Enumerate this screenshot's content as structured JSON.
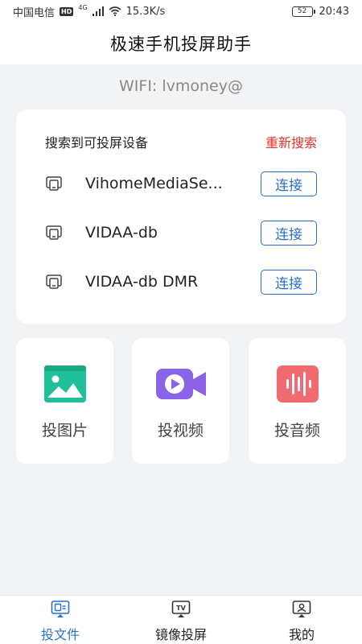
{
  "status_bar": {
    "carrier": "中国电信",
    "hd": "HD",
    "network": "4G",
    "speed": "15.3K/s",
    "battery": "52",
    "time": "20:43"
  },
  "header": {
    "title": "极速手机投屏助手"
  },
  "wifi": {
    "label": "WIFI: lvmoney@"
  },
  "device_card": {
    "title": "搜索到可投屏设备",
    "rescan_label": "重新搜索",
    "devices": [
      {
        "name": "VihomeMediaSe...",
        "connect_label": "连接",
        "icon": "cast-screen-icon"
      },
      {
        "name": "VIDAA-db",
        "connect_label": "连接",
        "icon": "cast-screen-icon"
      },
      {
        "name": "VIDAA-db DMR",
        "connect_label": "连接",
        "icon": "cast-screen-icon"
      }
    ]
  },
  "tiles": [
    {
      "label": "投图片",
      "icon": "image-icon",
      "color": "#1fbf9a"
    },
    {
      "label": "投视频",
      "icon": "video-camera-icon",
      "color": "#8a63e8"
    },
    {
      "label": "投音频",
      "icon": "audio-wave-icon",
      "color": "#f06a6f"
    }
  ],
  "bottom_nav": {
    "items": [
      {
        "label": "投文件",
        "icon": "cast-file-icon",
        "active": true
      },
      {
        "label": "镜像投屏",
        "icon": "tv-icon",
        "active": false
      },
      {
        "label": "我的",
        "icon": "profile-icon",
        "active": false
      }
    ]
  },
  "colors": {
    "accent": "#2a6fc9",
    "rescan": "#e8312a",
    "background": "#f2f3f5"
  }
}
